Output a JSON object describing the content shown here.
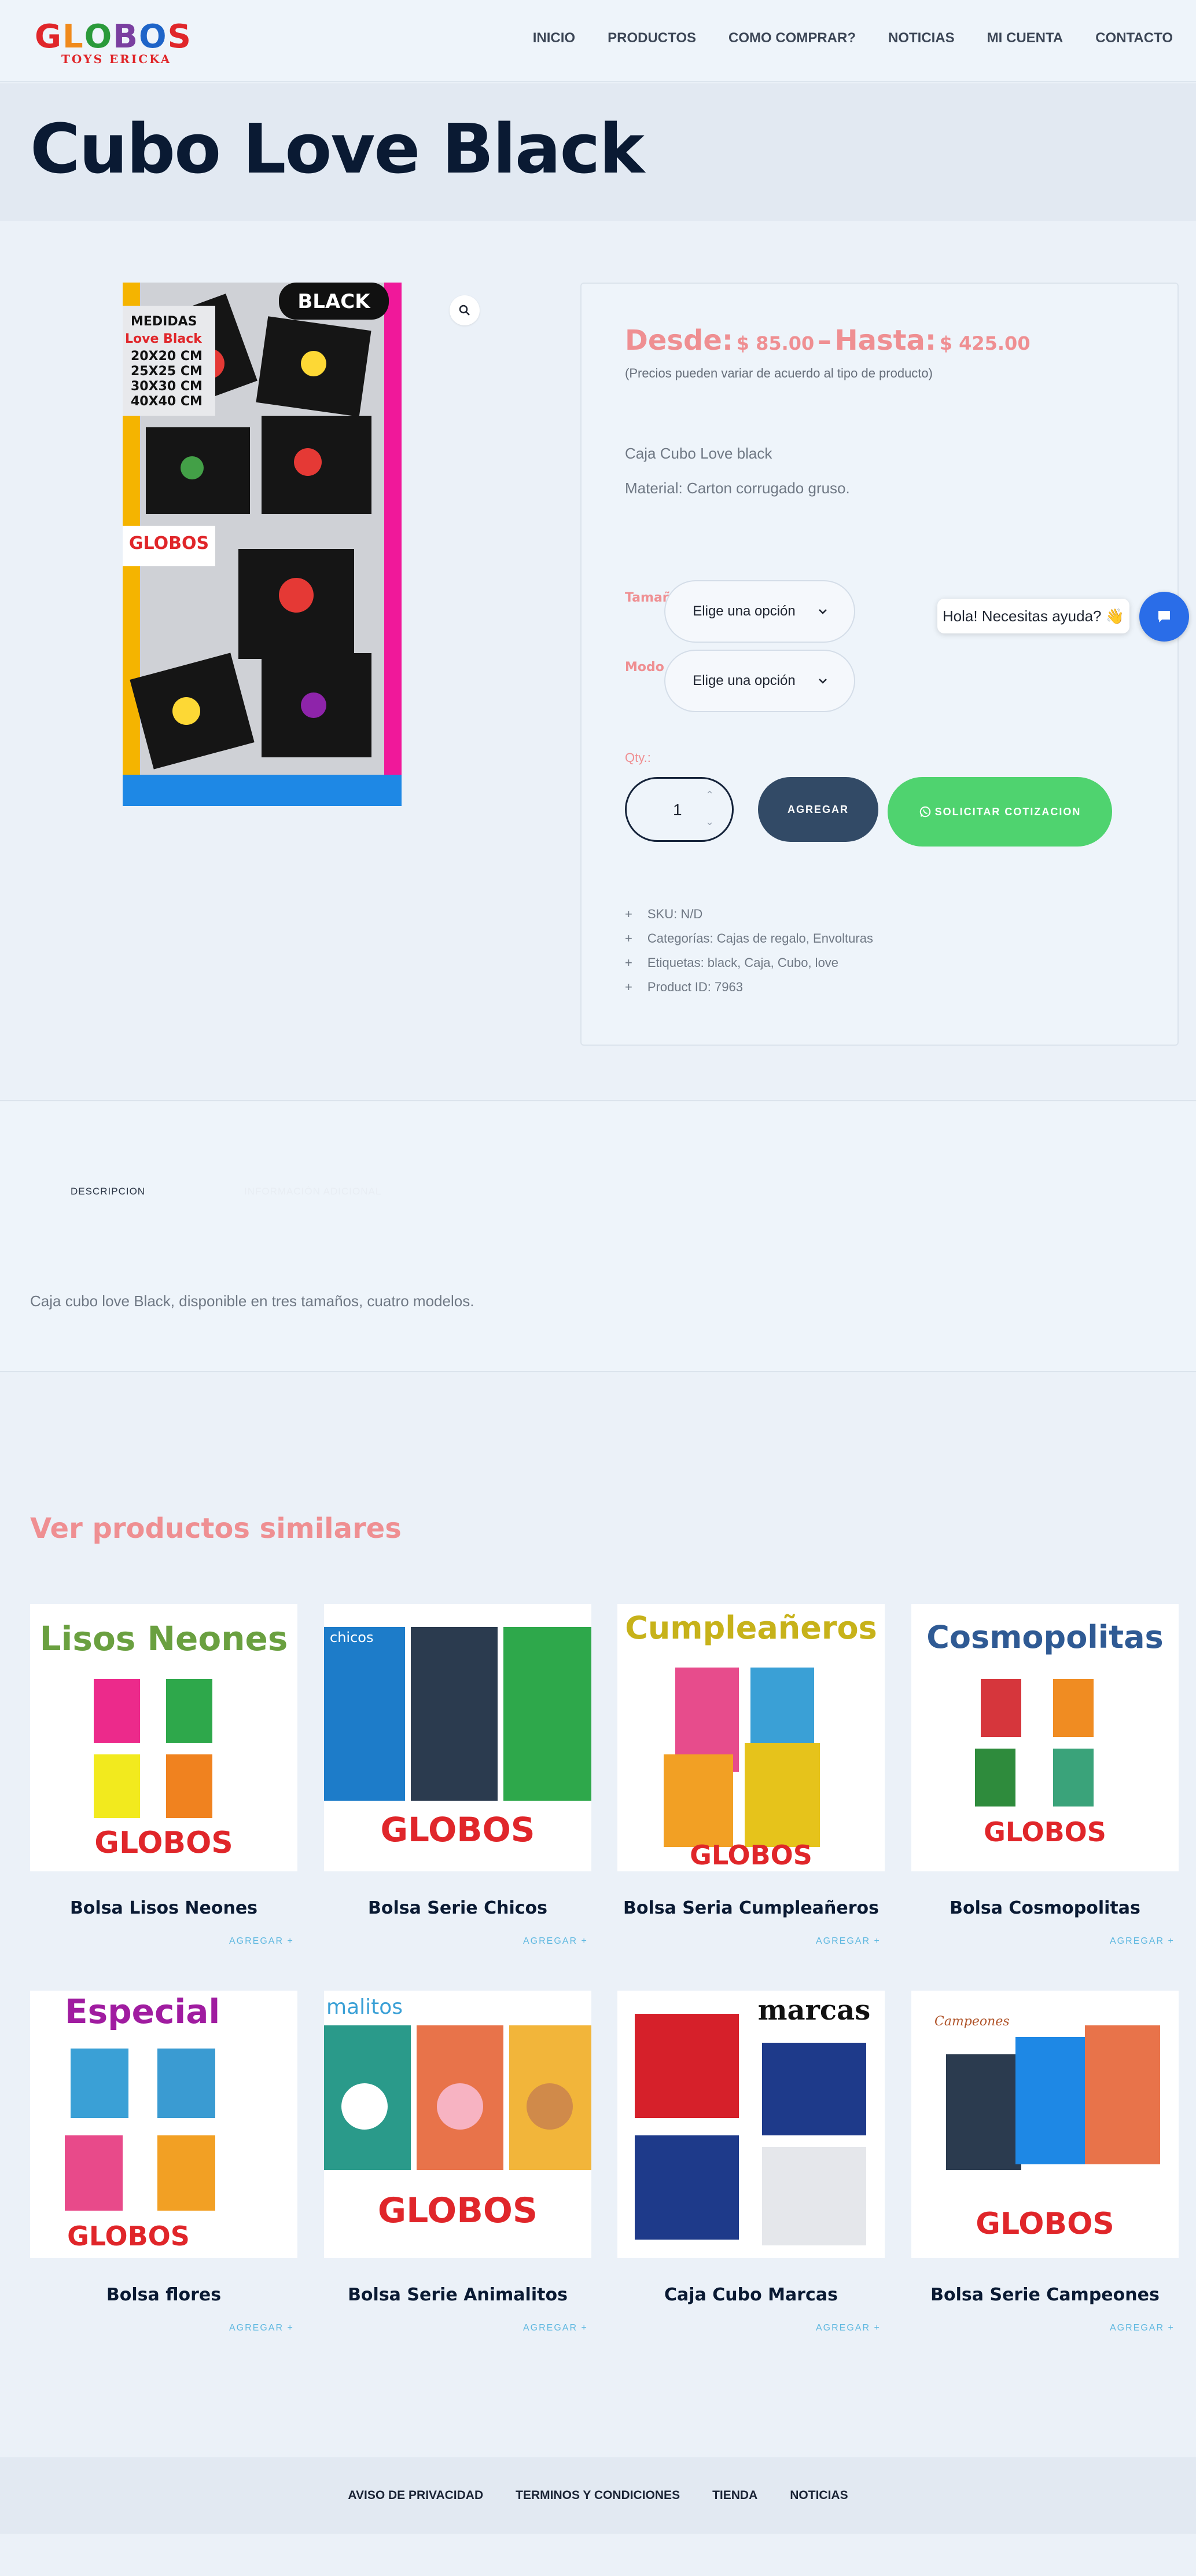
{
  "brand": {
    "logo_text": "GLOBOS",
    "logo_sub": "TOYS ERICKA"
  },
  "nav": {
    "items": [
      {
        "label": "INICIO"
      },
      {
        "label": "PRODUCTOS"
      },
      {
        "label": "COMO COMPRAR?"
      },
      {
        "label": "NOTICIAS"
      },
      {
        "label": "MI CUENTA"
      },
      {
        "label": "CONTACTO"
      }
    ]
  },
  "page": {
    "title": "Cubo Love Black"
  },
  "product": {
    "image_badge": "BLACK",
    "image_caption_lines": [
      "MEDIDAS",
      "Love Black",
      "20X20 CM",
      "25X25 CM",
      "30X30 CM",
      "40X40 CM"
    ],
    "image_logo": "GLOBOS",
    "price": {
      "from_label": "Desde:",
      "from_value": "$ 85.00",
      "dash": "–",
      "to_label": "Hasta:",
      "to_value": "$ 425.00",
      "note": "(Precios pueden variar de acuerdo al tipo de producto)"
    },
    "description": [
      "Caja Cubo Love black",
      "Material: Carton corrugado gruso."
    ],
    "variations": {
      "size_label": "Tamaño",
      "size_value": "Elige una opción",
      "mode_label": "Modo",
      "mode_value": "Elige una opción"
    },
    "qty_label": "Qty.:",
    "qty_value": "1",
    "add_button": "AGREGAR",
    "quote_button": "SOLICITAR COTIZACION",
    "meta": [
      {
        "text": "SKU: N/D"
      },
      {
        "text": "Categorías: Cajas de regalo, Envolturas"
      },
      {
        "text": "Etiquetas: black, Caja, Cubo, love"
      },
      {
        "text": "Product ID: 7963"
      }
    ]
  },
  "chat": {
    "bubble_text": "Hola! Necesitas ayuda? 👋"
  },
  "tabs": {
    "description_tab": "DESCRIPCION",
    "extra_tab": "INFORMACIÓN ADICIONAL",
    "description_text": "Caja cubo love Black, disponible en tres tamaños, cuatro modelos."
  },
  "similar": {
    "title": "Ver productos similares",
    "add_label": "AGREGAR  +",
    "products": [
      {
        "name": "Bolsa Lisos Neones",
        "banner": "Lisos Neones"
      },
      {
        "name": "Bolsa Serie Chicos",
        "banner": "chicos"
      },
      {
        "name": "Bolsa Seria Cumpleañeros",
        "banner": "Cumpleañeros"
      },
      {
        "name": "Bolsa Cosmopolitas",
        "banner": "Cosmopolitas"
      },
      {
        "name": "Bolsa flores",
        "banner": "Especial"
      },
      {
        "name": "Bolsa Serie Animalitos",
        "banner": "malitos"
      },
      {
        "name": "Caja Cubo Marcas",
        "banner": "marcas"
      },
      {
        "name": "Bolsa Serie Campeones",
        "banner": "Campeones"
      }
    ]
  },
  "footer": {
    "links": [
      {
        "label": "AVISO DE PRIVACIDAD"
      },
      {
        "label": "TERMINOS Y CONDICIONES"
      },
      {
        "label": "TIENDA"
      },
      {
        "label": "NOTICIAS"
      }
    ]
  }
}
